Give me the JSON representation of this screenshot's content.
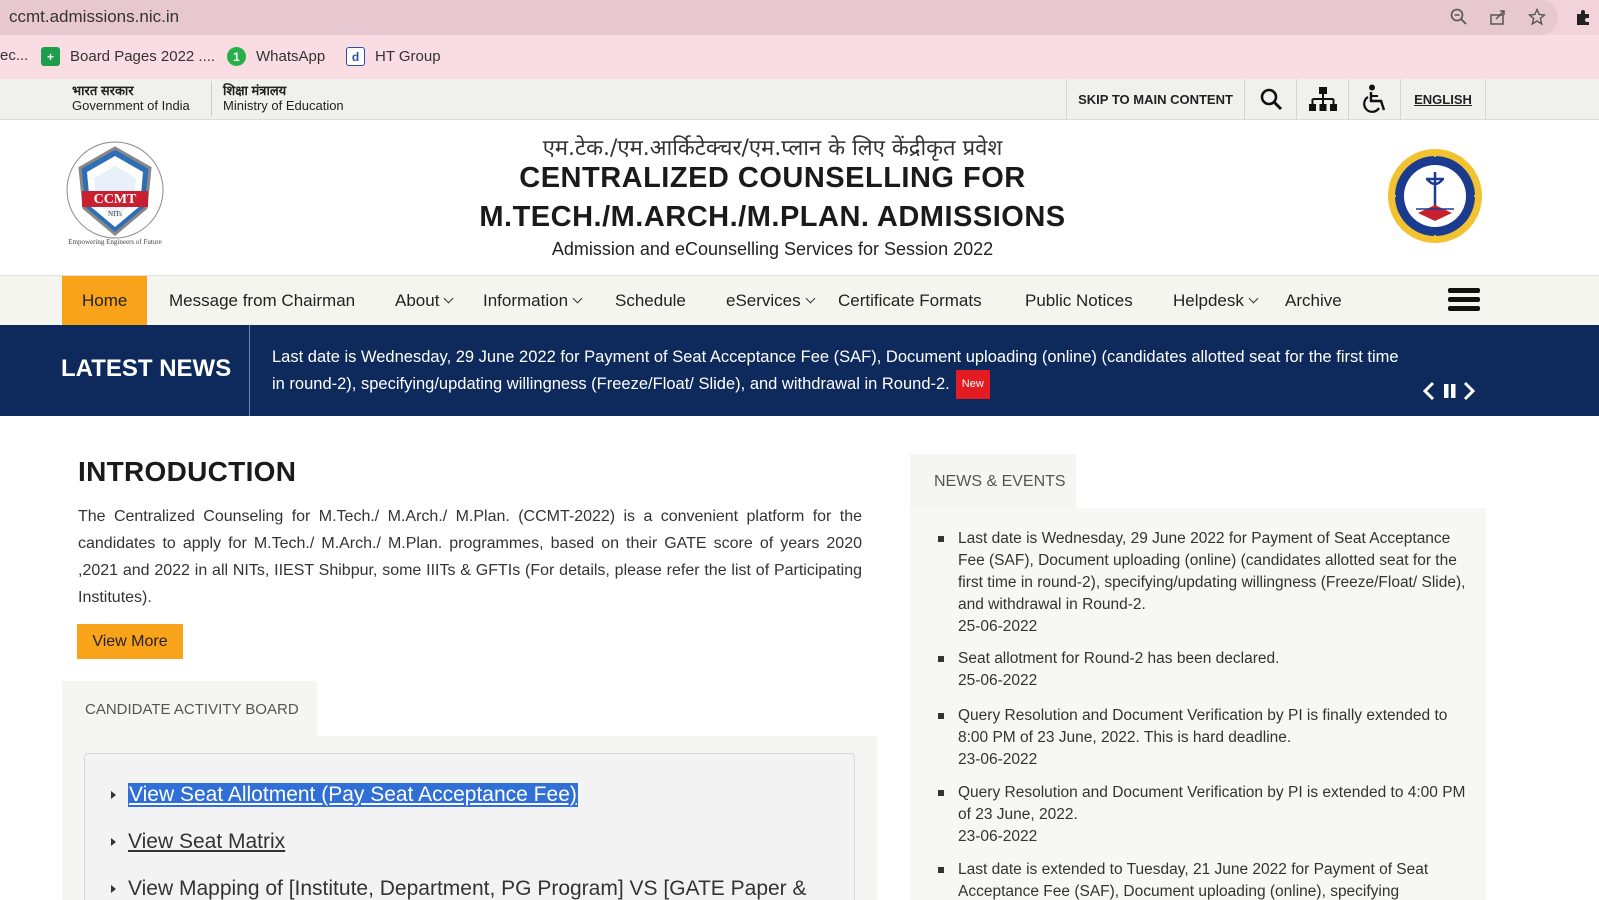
{
  "browser": {
    "url": "ccmt.admissions.nic.in",
    "bookmarks": [
      {
        "label": "ec...",
        "icon": "bookmark-partial-icon"
      },
      {
        "label": "Board Pages 2022 ....",
        "icon": "sheets-icon"
      },
      {
        "label": "WhatsApp",
        "icon": "whatsapp-icon"
      },
      {
        "label": "HT Group",
        "icon": "d-icon"
      }
    ]
  },
  "govbar": {
    "gov_hindi": "भारत सरकार",
    "gov_english": "Government of India",
    "ministry_hindi": "शिक्षा मंत्रालय",
    "ministry_english": "Ministry of Education",
    "skip": "SKIP TO MAIN CONTENT",
    "language": "ENGLISH"
  },
  "header": {
    "hindi_title": "एम.टेक./एम.आर्किटेक्चर/एम.प्लान के लिए केंद्रीकृत प्रवेश",
    "title_line1": "CENTRALIZED COUNSELLING FOR",
    "title_line2": "M.TECH./M.ARCH./M.PLAN. ADMISSIONS",
    "subtitle": "Admission and eCounselling Services for Session 2022",
    "logo_text": "CCMT",
    "logo_sub": "NITs",
    "logo_motto": "Empowering Engineers of Future"
  },
  "nav": {
    "items": [
      {
        "label": "Home"
      },
      {
        "label": "Message from Chairman"
      },
      {
        "label": "About"
      },
      {
        "label": "Information"
      },
      {
        "label": "Schedule"
      },
      {
        "label": "eServices"
      },
      {
        "label": "Certificate Formats"
      },
      {
        "label": "Public Notices"
      },
      {
        "label": "Helpdesk"
      },
      {
        "label": "Archive"
      }
    ]
  },
  "latest_news": {
    "label": "LATEST NEWS",
    "text": "Last date is Wednesday, 29 June 2022 for Payment of Seat Acceptance Fee (SAF), Document uploading (online) (candidates allotted seat for the first time in round-2), specifying/updating willingness (Freeze/Float/ Slide), and withdrawal in Round-2.",
    "badge": "New"
  },
  "intro": {
    "title": "INTRODUCTION",
    "text": "The Centralized Counseling for M.Tech./ M.Arch./ M.Plan. (CCMT-2022) is a convenient platform for the candidates to apply for M.Tech./ M.Arch./ M.Plan. programmes, based on their GATE score of years 2020 ,2021 and  2022 in all NITs, IIEST Shibpur, some IIITs & GFTIs (For details, please refer the list of Participating Institutes).",
    "button": "View More"
  },
  "activity_board": {
    "tab": "CANDIDATE ACTIVITY BOARD",
    "links": [
      "View Seat Allotment (Pay Seat Acceptance Fee)",
      "View Seat Matrix",
      "View Mapping of [Institute, Department, PG Program] VS [GATE Paper &"
    ]
  },
  "news_events": {
    "tab": "NEWS & EVENTS",
    "items": [
      {
        "text": "Last date is Wednesday, 29 June 2022 for Payment of Seat Acceptance Fee (SAF), Document uploading (online) (candidates allotted seat for the first time in round-2), specifying/updating willingness (Freeze/Float/ Slide), and withdrawal in Round-2.",
        "date": "25-06-2022"
      },
      {
        "text": "Seat allotment for Round-2 has been declared.",
        "date": "25-06-2022"
      },
      {
        "text": "Query Resolution and Document Verification by PI is finally extended to 8:00 PM of 23 June, 2022. This is hard deadline.",
        "date": "23-06-2022"
      },
      {
        "text": "Query Resolution and Document Verification by PI is extended to 4:00 PM of 23 June, 2022.",
        "date": "23-06-2022"
      },
      {
        "text": "Last date is extended to Tuesday, 21 June 2022 for Payment of Seat Acceptance Fee (SAF), Document uploading (online), specifying",
        "date": ""
      }
    ]
  },
  "colors": {
    "accent": "#f9a31a",
    "news_bg": "#0e2a5c",
    "selection": "#2f6fd6",
    "new_badge": "#e31b23"
  }
}
